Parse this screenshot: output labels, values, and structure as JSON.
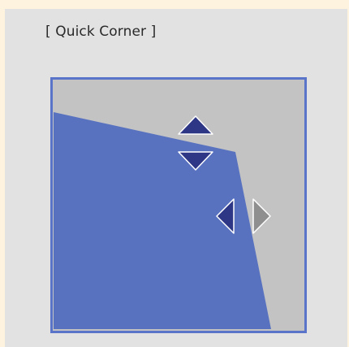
{
  "dialog": {
    "title": "[ Quick Corner ]"
  },
  "colors": {
    "page_background": "#fdf3df",
    "panel_background": "#e2e2e2",
    "screen_area": "#c3c3c3",
    "frame_border": "#5a74c9",
    "projected_image": "#5872c0",
    "arrow_active": "#2d3785",
    "arrow_inactive": "#8f8f8f",
    "arrow_outline": "#ffffff"
  },
  "controls": {
    "up_arrow": {
      "icon": "triangle-up",
      "state": "active"
    },
    "down_arrow": {
      "icon": "triangle-down",
      "state": "active"
    },
    "left_arrow": {
      "icon": "triangle-left",
      "state": "active"
    },
    "right_arrow": {
      "icon": "triangle-right",
      "state": "inactive"
    }
  }
}
